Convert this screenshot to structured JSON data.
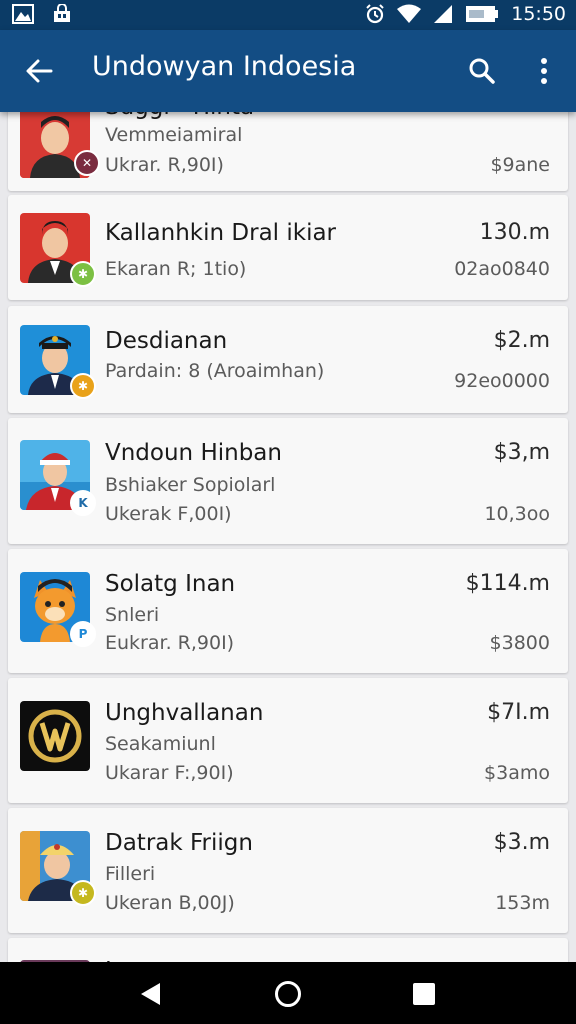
{
  "status_bar": {
    "time": "15:50"
  },
  "app_bar": {
    "title": "Undowyan Indoesia"
  },
  "items": [
    {
      "name": "Suggl - Hinta",
      "sub1": "Vemmeiamiral",
      "sub2": "Ukrar. R,90I)",
      "price": "",
      "value": "$9ane",
      "badge_color": "#7a2c3f",
      "badge_symbol": "✕"
    },
    {
      "name": "Kallanhkin Dral ikiar",
      "sub1": "",
      "sub2": "Ekaran R; 1tio)",
      "price": "130.m",
      "value": "02ao0840",
      "badge_color": "#7cc043",
      "badge_symbol": "✱"
    },
    {
      "name": "Desdianan",
      "sub1": "Pardain: 8 (Aroaimhan)",
      "sub2": "",
      "price": "$2.m",
      "value": "92eo0000",
      "badge_color": "#e9a21a",
      "badge_symbol": "✱"
    },
    {
      "name": "Vndoun Hinban",
      "sub1": "Bshiaker Sopiolarl",
      "sub2": "Ukerak F,00I)",
      "price": "$3,m",
      "value": "10,3oo",
      "badge_color": "#ffffff",
      "badge_symbol": "K"
    },
    {
      "name": "Solatg Inan",
      "sub1": "Snleri",
      "sub2": "Eukrar. R,90I)",
      "price": "$114.m",
      "value": "$3800",
      "badge_color": "#ffffff",
      "badge_symbol": "P"
    },
    {
      "name": "Unghvallanan",
      "sub1": "Seakamiunl",
      "sub2": "Ukarar F:,90I)",
      "price": "$7I.m",
      "value": "$3amo",
      "badge_color": "",
      "badge_symbol": ""
    },
    {
      "name": "Datrak Friign",
      "sub1": "Filleri",
      "sub2": "Ukeran B,00J)",
      "price": "$3.m",
      "value": "153m",
      "badge_color": "#c5b81f",
      "badge_symbol": "✱"
    },
    {
      "name": "L",
      "sub1": "",
      "sub2": "",
      "price": "",
      "value": "",
      "badge_color": "",
      "badge_symbol": ""
    }
  ]
}
